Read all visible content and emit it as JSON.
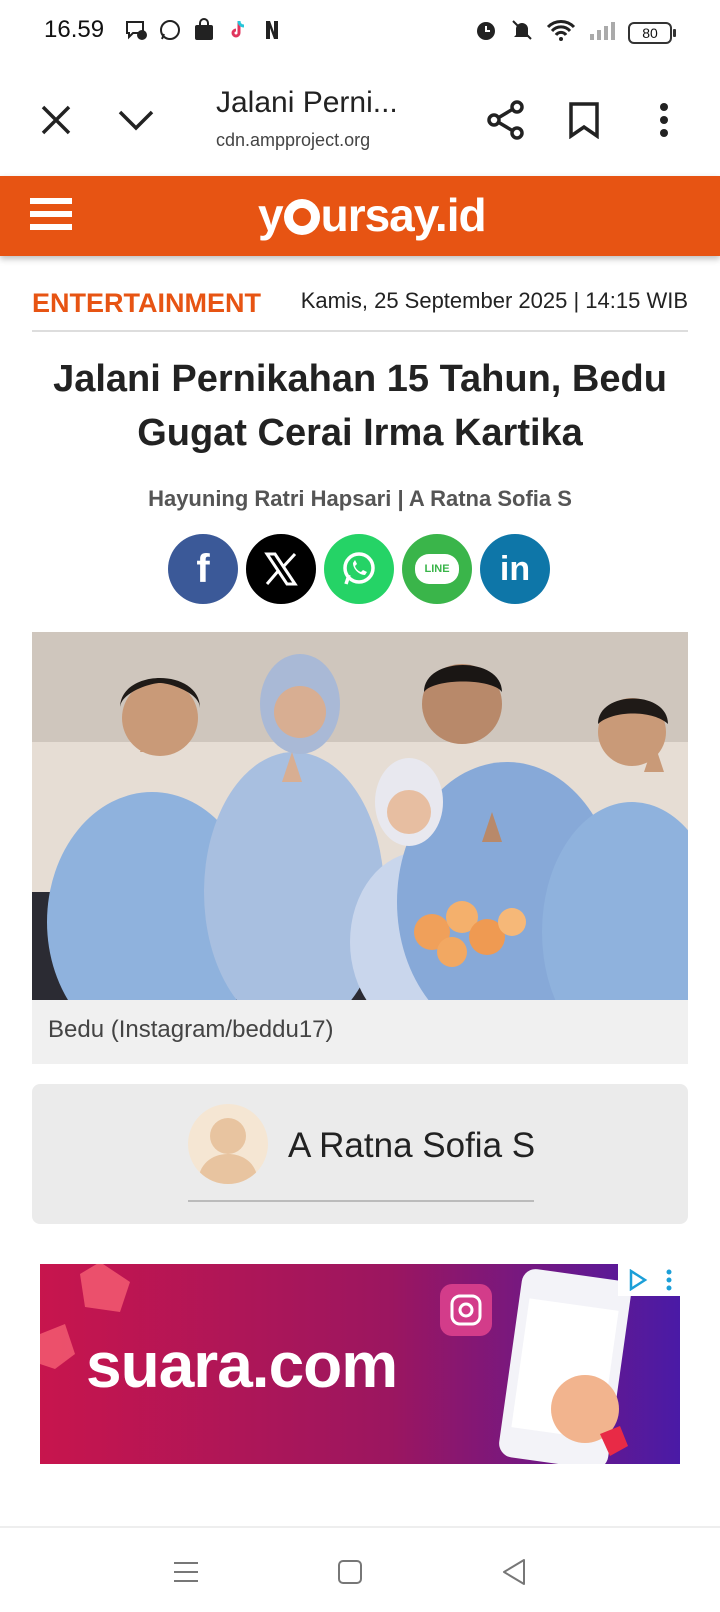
{
  "status_bar": {
    "time": "16.59",
    "battery": "80"
  },
  "browser": {
    "title": "Jalani Perni...",
    "url": "cdn.ampproject.org"
  },
  "site": {
    "logo_text_1": "y",
    "logo_text_2": "ursay.id"
  },
  "article": {
    "category": "ENTERTAINMENT",
    "date": "Kamis, 25 September 2025 | 14:15 WIB",
    "headline": "Jalani Pernikahan 15 Tahun, Bedu Gugat Cerai Irma Kartika",
    "authors": "Hayuning Ratri Hapsari | A Ratna Sofia S",
    "share": {
      "facebook": "f",
      "x": "X",
      "line": "LINE",
      "linkedin": "in"
    },
    "caption": "Bedu (Instagram/beddu17)",
    "author_card_name": "A Ratna Sofia S"
  },
  "ad": {
    "text": "suara.com"
  },
  "colors": {
    "brand": "#e75413",
    "facebook": "#3b5998",
    "whatsapp": "#25d366",
    "line": "#3ab54a",
    "linkedin": "#0e76a8"
  }
}
